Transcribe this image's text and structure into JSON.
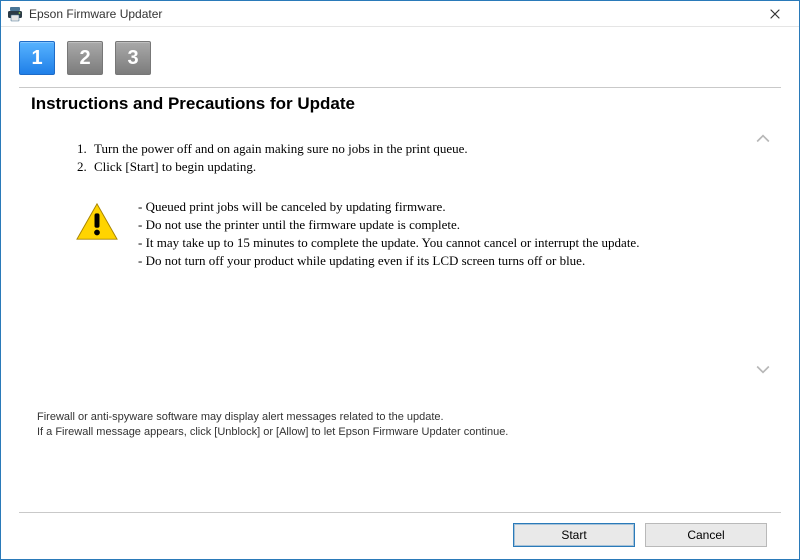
{
  "window": {
    "title": "Epson Firmware Updater"
  },
  "steps": [
    {
      "label": "1",
      "active": true
    },
    {
      "label": "2",
      "active": false
    },
    {
      "label": "3",
      "active": false
    }
  ],
  "heading": "Instructions and Precautions for Update",
  "instructions": [
    "Turn the power off and on again making sure no jobs in the print queue.",
    "Click [Start] to begin updating."
  ],
  "warnings": [
    "- Queued print jobs will be canceled by updating firmware.",
    "- Do not use the printer until the firmware update is complete.",
    "- It may take up to 15 minutes to complete the update. You cannot cancel or interrupt the update.",
    "- Do not turn off your product while updating even if its LCD screen turns off or blue."
  ],
  "footnote": [
    "Firewall or anti-spyware software may display alert messages related to the update.",
    "If a Firewall message appears, click [Unblock] or [Allow] to let Epson Firmware Updater continue."
  ],
  "buttons": {
    "start": "Start",
    "cancel": "Cancel"
  }
}
